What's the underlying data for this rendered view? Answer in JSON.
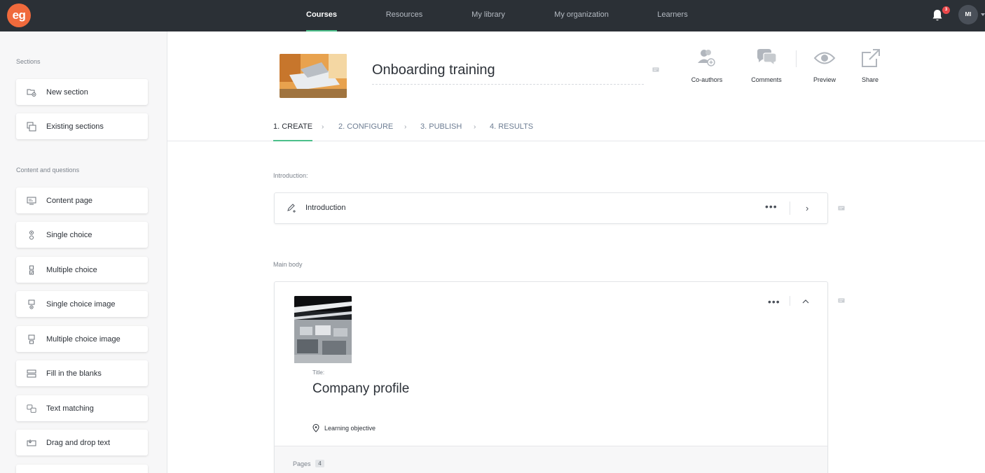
{
  "app": {
    "logo_text": "eg"
  },
  "nav": {
    "items": [
      {
        "label": "Courses"
      },
      {
        "label": "Resources"
      },
      {
        "label": "My library"
      },
      {
        "label": "My organization"
      },
      {
        "label": "Learners"
      }
    ],
    "notifications_count": "3",
    "avatar_initials": "MI"
  },
  "sidebar": {
    "sections_heading": "Sections",
    "sections": [
      {
        "label": "New section",
        "icon": "new-section-icon"
      },
      {
        "label": "Existing sections",
        "icon": "existing-sections-icon"
      }
    ],
    "content_heading": "Content and questions",
    "content": [
      {
        "label": "Content page",
        "icon": "content-page-icon"
      },
      {
        "label": "Single choice",
        "icon": "single-choice-icon"
      },
      {
        "label": "Multiple choice",
        "icon": "multiple-choice-icon"
      },
      {
        "label": "Single choice image",
        "icon": "single-choice-image-icon"
      },
      {
        "label": "Multiple choice image",
        "icon": "multiple-choice-image-icon"
      },
      {
        "label": "Fill in the blanks",
        "icon": "fill-blanks-icon"
      },
      {
        "label": "Text matching",
        "icon": "text-matching-icon"
      },
      {
        "label": "Drag and drop text",
        "icon": "drag-drop-icon"
      }
    ]
  },
  "course": {
    "title": "Onboarding training"
  },
  "actions": {
    "coauthors": "Co-authors",
    "comments": "Comments",
    "preview": "Preview",
    "share": "Share"
  },
  "steps": [
    {
      "label": "1. CREATE"
    },
    {
      "label": "2. CONFIGURE"
    },
    {
      "label": "3. PUBLISH"
    },
    {
      "label": "4. RESULTS"
    }
  ],
  "content": {
    "intro_heading": "Introduction:",
    "intro_item": "Introduction",
    "main_heading": "Main body",
    "section": {
      "title_caption": "Title:",
      "title": "Company profile",
      "learning_objective": "Learning objective",
      "pages_label": "Pages",
      "pages_count": "4"
    }
  },
  "colors": {
    "topbar": "#2b3036",
    "accent": "#4cbf8a",
    "logo": "#f06a3c",
    "badge": "#e8474a"
  }
}
